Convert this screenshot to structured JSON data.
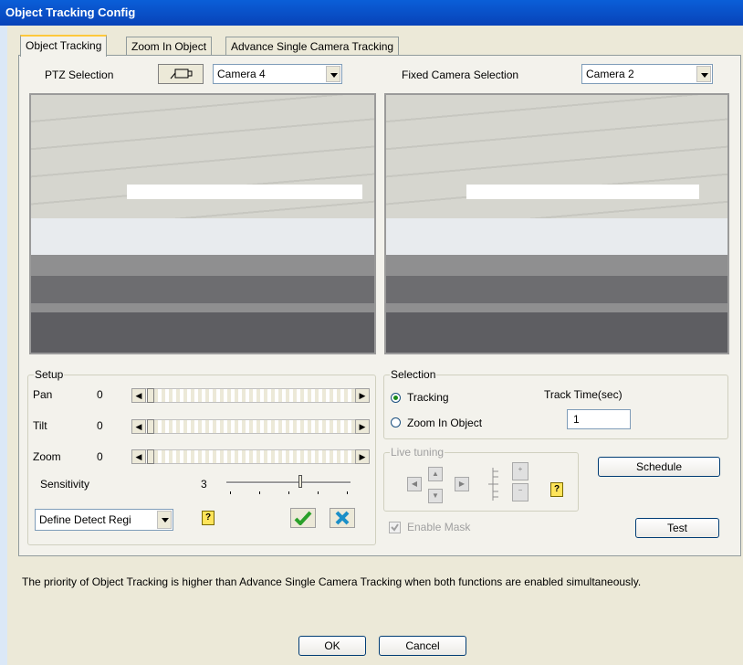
{
  "window": {
    "title": "Object Tracking Config"
  },
  "tabs": [
    {
      "label": "Object Tracking",
      "active": true
    },
    {
      "label": "Zoom In Object",
      "active": false
    },
    {
      "label": "Advance Single Camera Tracking",
      "active": false
    }
  ],
  "ptz": {
    "label": "PTZ Selection",
    "camera": "Camera 4",
    "icon": "ptz-camera-icon"
  },
  "fixed": {
    "label": "Fixed Camera Selection",
    "camera": "Camera 2"
  },
  "setup": {
    "legend": "Setup",
    "pan": {
      "label": "Pan",
      "value": "0"
    },
    "tilt": {
      "label": "Tilt",
      "value": "0"
    },
    "zoom": {
      "label": "Zoom",
      "value": "0"
    },
    "sensitivity": {
      "label": "Sensitivity",
      "value": "3",
      "level": 0.6
    },
    "detect_region": "Define Detect Regi"
  },
  "selection": {
    "legend": "Selection",
    "tracking": "Tracking",
    "zoom_in": "Zoom In Object",
    "selected": "Tracking",
    "track_time_label": "Track Time(sec)",
    "track_time_value": "1"
  },
  "live_tuning": {
    "legend": "Live tuning"
  },
  "enable_mask": {
    "label": "Enable Mask",
    "checked": true
  },
  "buttons": {
    "schedule": "Schedule",
    "test": "Test",
    "ok": "OK",
    "cancel": "Cancel"
  },
  "note": "The priority of Object Tracking is higher than Advance Single Camera Tracking when both functions are enabled simultaneously.",
  "colors": {
    "title_bar": "#0a5fd8",
    "panel": "#ece9d8",
    "accent_check": "#2aa02a",
    "accent_cross": "#1a8fc8"
  }
}
